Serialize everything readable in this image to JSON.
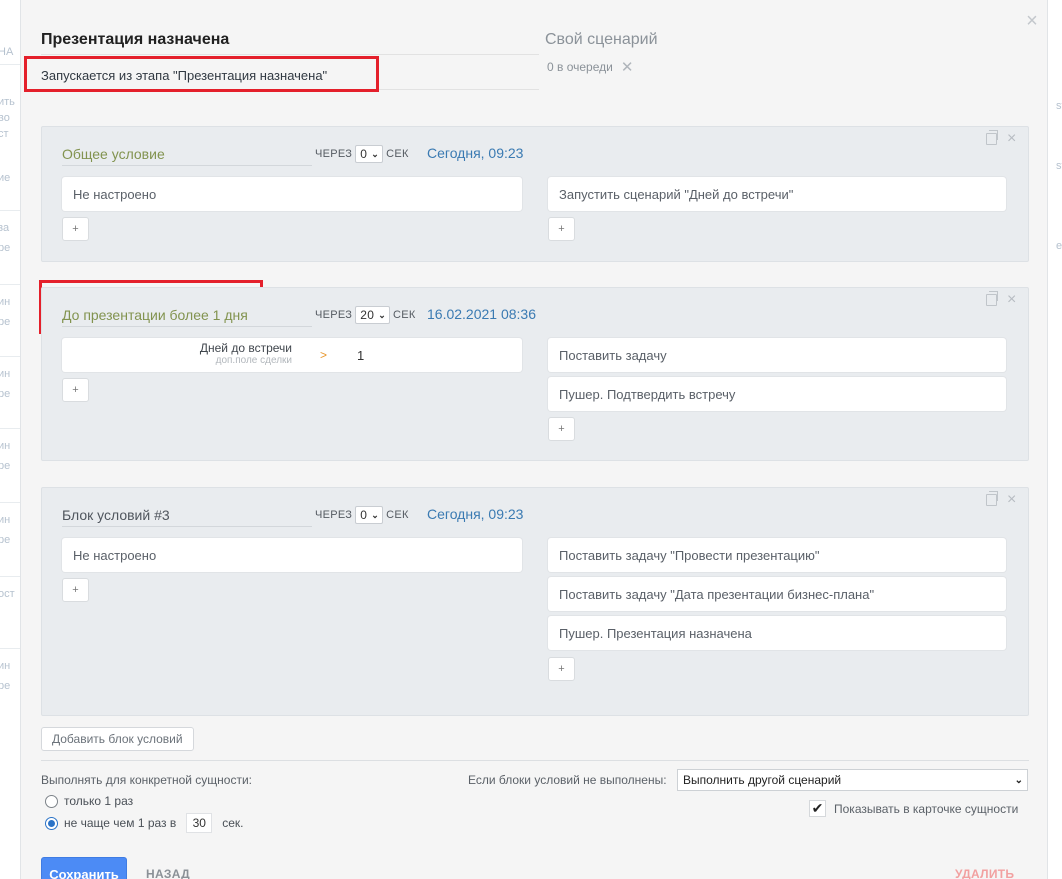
{
  "header": {
    "title": "Презентация назначена",
    "subtitle": "Запускается из этапа \"Презентация назначена\"",
    "scenario_label": "Свой сценарий",
    "queue_text": "0 в очереди"
  },
  "background": {
    "left_fragments": [
      "НА",
      "ить",
      "во",
      "ст",
      "ие",
      "за",
      "ре",
      "ин",
      "ре",
      "ин",
      "ре",
      "ин",
      "ре",
      "ин",
      "ре",
      "ост",
      "ин",
      "ре"
    ],
    "right_fragments": [
      "st",
      "st",
      "e"
    ]
  },
  "blocks": [
    {
      "name": "Общее условие",
      "through_label": "ЧЕРЕЗ",
      "delay_value": "0",
      "sec_label": "СЕК",
      "date": "Сегодня, 09:23",
      "condition_text": "Не настроено",
      "actions": [
        "Запустить сценарий \"Дней до встречи\""
      ],
      "plus": "+"
    },
    {
      "name": "До презентации более 1 дня",
      "through_label": "ЧЕРЕЗ",
      "delay_value": "20",
      "sec_label": "СЕК",
      "date": "16.02.2021 08:36",
      "condition": {
        "field_name": "Дней до встречи",
        "field_sub": "доп.поле сделки",
        "operator": ">",
        "value": "1"
      },
      "actions": [
        "Поставить задачу",
        "Пушер. Подтвердить встречу"
      ],
      "plus": "+"
    },
    {
      "name": "Блок условий #3",
      "through_label": "ЧЕРЕЗ",
      "delay_value": "0",
      "sec_label": "СЕК",
      "date": "Сегодня, 09:23",
      "condition_text": "Не настроено",
      "actions": [
        "Поставить задачу \"Провести презентацию\"",
        "Поставить задачу \"Дата презентации бизнес-плана\"",
        "Пушер. Презентация назначена"
      ],
      "plus": "+"
    }
  ],
  "footer": {
    "add_block_label": "Добавить блок условий",
    "exec_label": "Выполнять для конкретной сущности:",
    "radio_once": "только 1 раз",
    "radio_not_often": "не чаще чем 1 раз в",
    "interval_value": "30",
    "interval_unit": "сек.",
    "if_not_label": "Если блоки условий не выполнены:",
    "fallback_select": "Выполнить другой сценарий",
    "show_in_card": "Показывать в карточке сущности",
    "save_label": "Сохранить",
    "back_label": "НАЗАД",
    "delete_label": "УДАЛИТЬ"
  },
  "colors": {
    "highlight_box": "#e4202b",
    "block_title_green": "#82934f",
    "date_link": "#3a7ab2",
    "save_button": "#4c8bf5"
  }
}
